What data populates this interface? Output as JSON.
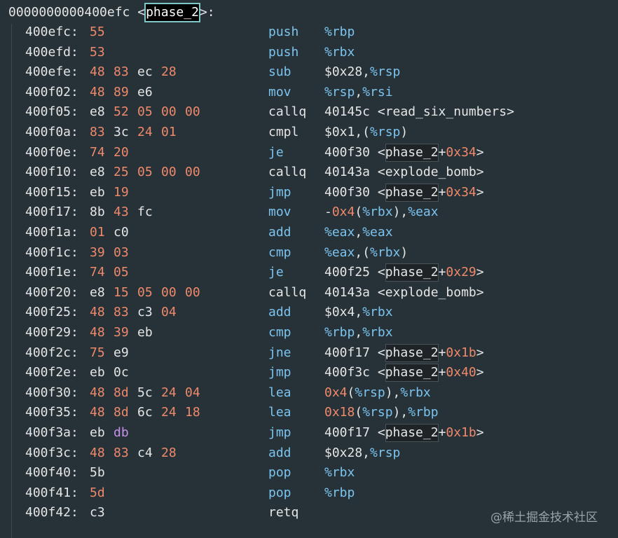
{
  "colors": {
    "background": "#263238",
    "default_text": "#e6e6e6",
    "address": "#e6e6e6",
    "number_orange": "#f0896b",
    "register_blue": "#7cc4ef",
    "mnemonic_blue": "#7cc4ef",
    "mnemonic_white": "#e6e6e6",
    "purple": "#c792ea"
  },
  "header": {
    "address": "0000000000400efc",
    "open": " <",
    "symbol": "phase_2",
    "close": ">:"
  },
  "watermark": "@稀土掘金技术社区",
  "rows": [
    {
      "addr": "400efc",
      "bytes": [
        {
          "t": "55",
          "c": "o"
        }
      ],
      "mnem": "push",
      "mc": "b",
      "ops": [
        {
          "t": "%rbp",
          "c": "b"
        }
      ]
    },
    {
      "addr": "400efd",
      "bytes": [
        {
          "t": "53",
          "c": "o"
        }
      ],
      "mnem": "push",
      "mc": "b",
      "ops": [
        {
          "t": "%rbx",
          "c": "b"
        }
      ]
    },
    {
      "addr": "400efe",
      "bytes": [
        {
          "t": "48",
          "c": "o"
        },
        {
          "t": "83",
          "c": "o"
        },
        {
          "t": "ec",
          "c": "w"
        },
        {
          "t": "28",
          "c": "o"
        }
      ],
      "mnem": "sub",
      "mc": "b",
      "ops": [
        {
          "t": "$0x28,",
          "c": "w"
        },
        {
          "t": "%rsp",
          "c": "b"
        }
      ]
    },
    {
      "addr": "400f02",
      "bytes": [
        {
          "t": "48",
          "c": "o"
        },
        {
          "t": "89",
          "c": "o"
        },
        {
          "t": "e6",
          "c": "w"
        }
      ],
      "mnem": "mov",
      "mc": "b",
      "ops": [
        {
          "t": "%rsp",
          "c": "b"
        },
        {
          "t": ",",
          "c": "w"
        },
        {
          "t": "%rsi",
          "c": "b"
        }
      ]
    },
    {
      "addr": "400f05",
      "bytes": [
        {
          "t": "e8",
          "c": "w"
        },
        {
          "t": "52",
          "c": "o"
        },
        {
          "t": "05",
          "c": "o"
        },
        {
          "t": "00",
          "c": "o"
        },
        {
          "t": "00",
          "c": "o"
        }
      ],
      "mnem": "callq",
      "mc": "w",
      "ops": [
        {
          "t": "40145c <read_six_numbers>",
          "c": "w"
        }
      ]
    },
    {
      "addr": "400f0a",
      "bytes": [
        {
          "t": "83",
          "c": "o"
        },
        {
          "t": "3c",
          "c": "w"
        },
        {
          "t": "24",
          "c": "o"
        },
        {
          "t": "01",
          "c": "o"
        }
      ],
      "mnem": "cmpl",
      "mc": "w",
      "ops": [
        {
          "t": "$0x1,(",
          "c": "w"
        },
        {
          "t": "%rsp",
          "c": "b"
        },
        {
          "t": ")",
          "c": "w"
        }
      ]
    },
    {
      "addr": "400f0e",
      "bytes": [
        {
          "t": "74",
          "c": "o"
        },
        {
          "t": "20",
          "c": "o"
        }
      ],
      "mnem": "je",
      "mc": "b",
      "ops": [
        {
          "t": "400f30 <",
          "c": "w"
        },
        {
          "t": "phase_2",
          "c": "w",
          "s": true
        },
        {
          "t": "+",
          "c": "w"
        },
        {
          "t": "0x34",
          "c": "o"
        },
        {
          "t": ">",
          "c": "w"
        }
      ]
    },
    {
      "addr": "400f10",
      "bytes": [
        {
          "t": "e8",
          "c": "w"
        },
        {
          "t": "25",
          "c": "o"
        },
        {
          "t": "05",
          "c": "o"
        },
        {
          "t": "00",
          "c": "o"
        },
        {
          "t": "00",
          "c": "o"
        }
      ],
      "mnem": "callq",
      "mc": "w",
      "ops": [
        {
          "t": "40143a <explode_bomb>",
          "c": "w"
        }
      ]
    },
    {
      "addr": "400f15",
      "bytes": [
        {
          "t": "eb",
          "c": "w"
        },
        {
          "t": "19",
          "c": "o"
        }
      ],
      "mnem": "jmp",
      "mc": "b",
      "ops": [
        {
          "t": "400f30 <",
          "c": "w"
        },
        {
          "t": "phase_2",
          "c": "w",
          "s": true
        },
        {
          "t": "+",
          "c": "w"
        },
        {
          "t": "0x34",
          "c": "o"
        },
        {
          "t": ">",
          "c": "w"
        }
      ]
    },
    {
      "addr": "400f17",
      "bytes": [
        {
          "t": "8b",
          "c": "w"
        },
        {
          "t": "43",
          "c": "o"
        },
        {
          "t": "fc",
          "c": "w"
        }
      ],
      "mnem": "mov",
      "mc": "b",
      "ops": [
        {
          "t": "-",
          "c": "w"
        },
        {
          "t": "0x4",
          "c": "o"
        },
        {
          "t": "(",
          "c": "w"
        },
        {
          "t": "%rbx",
          "c": "b"
        },
        {
          "t": "),",
          "c": "w"
        },
        {
          "t": "%eax",
          "c": "b"
        }
      ]
    },
    {
      "addr": "400f1a",
      "bytes": [
        {
          "t": "01",
          "c": "o"
        },
        {
          "t": "c0",
          "c": "w"
        }
      ],
      "mnem": "add",
      "mc": "b",
      "ops": [
        {
          "t": "%eax",
          "c": "b"
        },
        {
          "t": ",",
          "c": "w"
        },
        {
          "t": "%eax",
          "c": "b"
        }
      ]
    },
    {
      "addr": "400f1c",
      "bytes": [
        {
          "t": "39",
          "c": "o"
        },
        {
          "t": "03",
          "c": "o"
        }
      ],
      "mnem": "cmp",
      "mc": "b",
      "ops": [
        {
          "t": "%eax",
          "c": "b"
        },
        {
          "t": ",(",
          "c": "w"
        },
        {
          "t": "%rbx",
          "c": "b"
        },
        {
          "t": ")",
          "c": "w"
        }
      ]
    },
    {
      "addr": "400f1e",
      "bytes": [
        {
          "t": "74",
          "c": "o"
        },
        {
          "t": "05",
          "c": "o"
        }
      ],
      "mnem": "je",
      "mc": "b",
      "ops": [
        {
          "t": "400f25 <",
          "c": "w"
        },
        {
          "t": "phase_2",
          "c": "w",
          "s": true
        },
        {
          "t": "+",
          "c": "w"
        },
        {
          "t": "0x29",
          "c": "o"
        },
        {
          "t": ">",
          "c": "w"
        }
      ]
    },
    {
      "addr": "400f20",
      "bytes": [
        {
          "t": "e8",
          "c": "w"
        },
        {
          "t": "15",
          "c": "o"
        },
        {
          "t": "05",
          "c": "o"
        },
        {
          "t": "00",
          "c": "o"
        },
        {
          "t": "00",
          "c": "o"
        }
      ],
      "mnem": "callq",
      "mc": "w",
      "ops": [
        {
          "t": "40143a <explode_bomb>",
          "c": "w"
        }
      ]
    },
    {
      "addr": "400f25",
      "bytes": [
        {
          "t": "48",
          "c": "o"
        },
        {
          "t": "83",
          "c": "o"
        },
        {
          "t": "c3",
          "c": "w"
        },
        {
          "t": "04",
          "c": "o"
        }
      ],
      "mnem": "add",
      "mc": "b",
      "ops": [
        {
          "t": "$0x4,",
          "c": "w"
        },
        {
          "t": "%rbx",
          "c": "b"
        }
      ]
    },
    {
      "addr": "400f29",
      "bytes": [
        {
          "t": "48",
          "c": "o"
        },
        {
          "t": "39",
          "c": "o"
        },
        {
          "t": "eb",
          "c": "w"
        }
      ],
      "mnem": "cmp",
      "mc": "b",
      "ops": [
        {
          "t": "%rbp",
          "c": "b"
        },
        {
          "t": ",",
          "c": "w"
        },
        {
          "t": "%rbx",
          "c": "b"
        }
      ]
    },
    {
      "addr": "400f2c",
      "bytes": [
        {
          "t": "75",
          "c": "o"
        },
        {
          "t": "e9",
          "c": "w"
        }
      ],
      "mnem": "jne",
      "mc": "b",
      "ops": [
        {
          "t": "400f17 <",
          "c": "w"
        },
        {
          "t": "phase_2",
          "c": "w",
          "s": true
        },
        {
          "t": "+",
          "c": "w"
        },
        {
          "t": "0x1b",
          "c": "o"
        },
        {
          "t": ">",
          "c": "w"
        }
      ]
    },
    {
      "addr": "400f2e",
      "bytes": [
        {
          "t": "eb",
          "c": "w"
        },
        {
          "t": "0c",
          "c": "w"
        }
      ],
      "mnem": "jmp",
      "mc": "b",
      "ops": [
        {
          "t": "400f3c <",
          "c": "w"
        },
        {
          "t": "phase_2",
          "c": "w",
          "s": true
        },
        {
          "t": "+",
          "c": "w"
        },
        {
          "t": "0x40",
          "c": "o"
        },
        {
          "t": ">",
          "c": "w"
        }
      ]
    },
    {
      "addr": "400f30",
      "bytes": [
        {
          "t": "48",
          "c": "o"
        },
        {
          "t": "8d",
          "c": "o"
        },
        {
          "t": "5c",
          "c": "w"
        },
        {
          "t": "24",
          "c": "o"
        },
        {
          "t": "04",
          "c": "o"
        }
      ],
      "mnem": "lea",
      "mc": "b",
      "ops": [
        {
          "t": "0x4",
          "c": "o"
        },
        {
          "t": "(",
          "c": "w"
        },
        {
          "t": "%rsp",
          "c": "b"
        },
        {
          "t": "),",
          "c": "w"
        },
        {
          "t": "%rbx",
          "c": "b"
        }
      ]
    },
    {
      "addr": "400f35",
      "bytes": [
        {
          "t": "48",
          "c": "o"
        },
        {
          "t": "8d",
          "c": "o"
        },
        {
          "t": "6c",
          "c": "w"
        },
        {
          "t": "24",
          "c": "o"
        },
        {
          "t": "18",
          "c": "o"
        }
      ],
      "mnem": "lea",
      "mc": "b",
      "ops": [
        {
          "t": "0x18",
          "c": "o"
        },
        {
          "t": "(",
          "c": "w"
        },
        {
          "t": "%rsp",
          "c": "b"
        },
        {
          "t": "),",
          "c": "w"
        },
        {
          "t": "%rbp",
          "c": "b"
        }
      ]
    },
    {
      "addr": "400f3a",
      "bytes": [
        {
          "t": "eb",
          "c": "w"
        },
        {
          "t": "db",
          "c": "p"
        }
      ],
      "mnem": "jmp",
      "mc": "b",
      "ops": [
        {
          "t": "400f17 <",
          "c": "w"
        },
        {
          "t": "phase_2",
          "c": "w",
          "s": true
        },
        {
          "t": "+",
          "c": "w"
        },
        {
          "t": "0x1b",
          "c": "o"
        },
        {
          "t": ">",
          "c": "w"
        }
      ]
    },
    {
      "addr": "400f3c",
      "bytes": [
        {
          "t": "48",
          "c": "o"
        },
        {
          "t": "83",
          "c": "o"
        },
        {
          "t": "c4",
          "c": "w"
        },
        {
          "t": "28",
          "c": "o"
        }
      ],
      "mnem": "add",
      "mc": "b",
      "ops": [
        {
          "t": "$0x28,",
          "c": "w"
        },
        {
          "t": "%rsp",
          "c": "b"
        }
      ]
    },
    {
      "addr": "400f40",
      "bytes": [
        {
          "t": "5b",
          "c": "w"
        }
      ],
      "mnem": "pop",
      "mc": "b",
      "ops": [
        {
          "t": "%rbx",
          "c": "b"
        }
      ]
    },
    {
      "addr": "400f41",
      "bytes": [
        {
          "t": "5d",
          "c": "o"
        }
      ],
      "mnem": "pop",
      "mc": "b",
      "ops": [
        {
          "t": "%rbp",
          "c": "b"
        }
      ]
    },
    {
      "addr": "400f42",
      "bytes": [
        {
          "t": "c3",
          "c": "w"
        }
      ],
      "mnem": "retq",
      "mc": "w",
      "ops": []
    }
  ]
}
